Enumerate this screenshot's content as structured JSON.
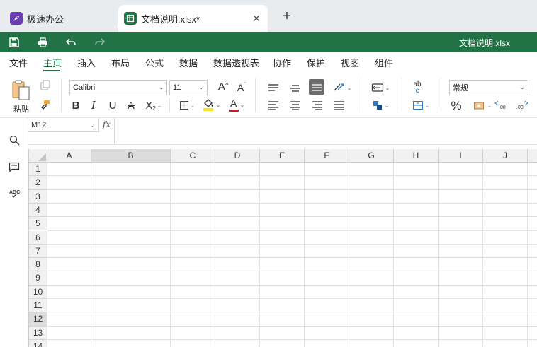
{
  "tabs": {
    "home_label": "极速办公",
    "doc_label": "文档说明.xlsx*",
    "close_symbol": "✕",
    "new_symbol": "+"
  },
  "quickbar": {
    "title": "文档说明.xlsx",
    "color": "#217346"
  },
  "menu": [
    "文件",
    "主页",
    "插入",
    "布局",
    "公式",
    "数据",
    "数据透视表",
    "协作",
    "保护",
    "视图",
    "组件"
  ],
  "menu_active": "主页",
  "ribbon": {
    "paste_label": "粘贴",
    "font_name": "Calibri",
    "font_size": "11",
    "number_format": "常规",
    "bold": "B",
    "italic": "I",
    "underline": "U",
    "strike": "A",
    "subscript": "X",
    "grow": "A",
    "shrink": "A",
    "font_color_letter": "A",
    "percent": "%",
    "abc": "ab",
    "abc2": "c"
  },
  "formula_bar": {
    "cell_ref": "M12",
    "fx": "fx",
    "value": ""
  },
  "sheet": {
    "columns": [
      "A",
      "B",
      "C",
      "D",
      "E",
      "F",
      "G",
      "H",
      "I",
      "J"
    ],
    "selected_column": "B",
    "rows": [
      "1",
      "2",
      "3",
      "4",
      "5",
      "6",
      "7",
      "8",
      "9",
      "10",
      "11",
      "12",
      "13",
      "14"
    ],
    "selected_row": "12"
  }
}
